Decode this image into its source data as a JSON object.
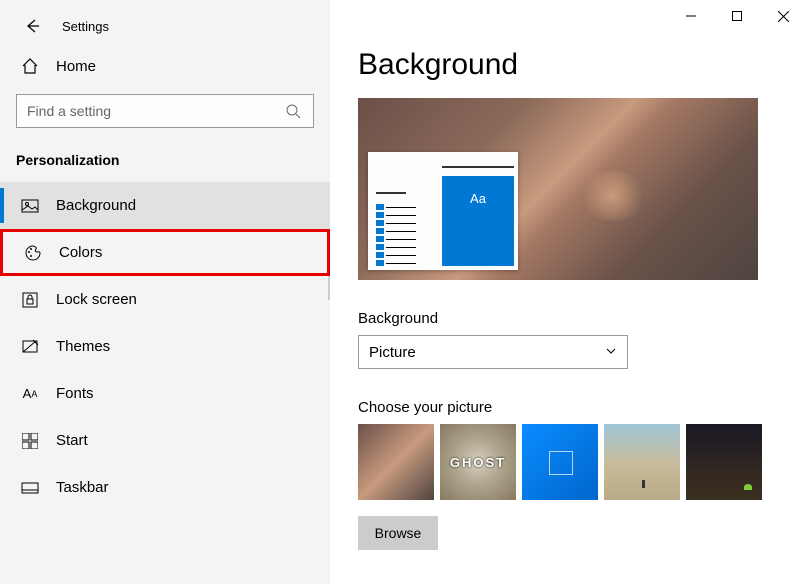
{
  "titlebar": {
    "title": "Settings"
  },
  "home": {
    "label": "Home"
  },
  "search": {
    "placeholder": "Find a setting"
  },
  "section": {
    "title": "Personalization"
  },
  "nav": {
    "background": "Background",
    "colors": "Colors",
    "lockscreen": "Lock screen",
    "themes": "Themes",
    "fonts": "Fonts",
    "start": "Start",
    "taskbar": "Taskbar"
  },
  "main": {
    "title": "Background",
    "preview_sample_text": "Aa",
    "bg_label": "Background",
    "bg_value": "Picture",
    "choose_label": "Choose your picture",
    "browse_label": "Browse"
  }
}
